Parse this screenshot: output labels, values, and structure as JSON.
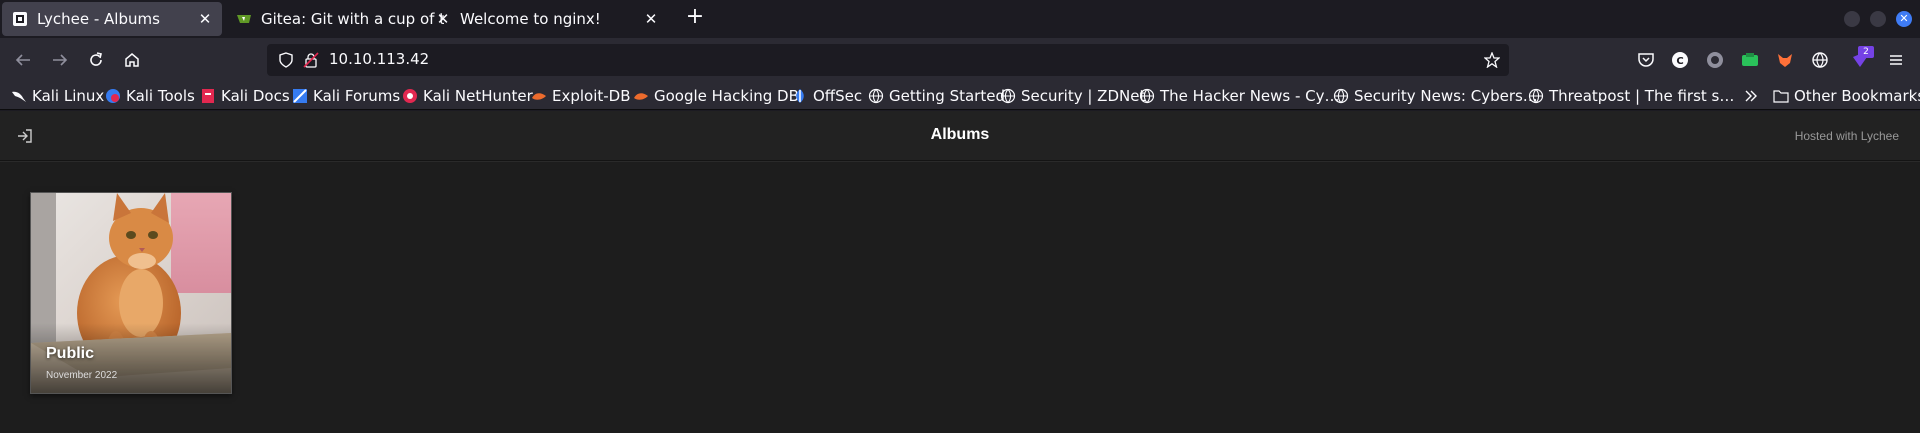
{
  "browser": {
    "tabs": [
      {
        "title": "Lychee - Albums",
        "active": true
      },
      {
        "title": "Gitea: Git with a cup of tea",
        "active": false
      },
      {
        "title": "Welcome to nginx!",
        "active": false
      }
    ],
    "url": "10.10.113.42",
    "extension_badge": "2",
    "bookmarks": [
      {
        "label": "Kali Linux",
        "icon": "kali-icon"
      },
      {
        "label": "Kali Tools",
        "icon": "kali-tools-icon"
      },
      {
        "label": "Kali Docs",
        "icon": "kali-docs-icon"
      },
      {
        "label": "Kali Forums",
        "icon": "kali-forums-icon"
      },
      {
        "label": "Kali NetHunter",
        "icon": "nethunter-icon"
      },
      {
        "label": "Exploit-DB",
        "icon": "exploitdb-icon"
      },
      {
        "label": "Google Hacking DB",
        "icon": "ghdb-icon"
      },
      {
        "label": "OffSec",
        "icon": "offsec-icon"
      },
      {
        "label": "Getting Started",
        "icon": "globe-icon"
      },
      {
        "label": "Security | ZDNet",
        "icon": "globe-icon"
      },
      {
        "label": "The Hacker News - Cy…",
        "icon": "globe-icon"
      },
      {
        "label": "Security News: Cybers…",
        "icon": "globe-icon"
      },
      {
        "label": "Threatpost | The first s…",
        "icon": "globe-icon"
      }
    ],
    "other_bookmarks": "Other Bookmarks"
  },
  "lychee": {
    "title": "Albums",
    "hosted": "Hosted with Lychee",
    "albums": [
      {
        "title": "Public",
        "date": "November 2022"
      }
    ]
  },
  "colors": {
    "accent": "#3f7cf5",
    "page_bg": "#1d1d1d",
    "header_bg": "#222222"
  }
}
